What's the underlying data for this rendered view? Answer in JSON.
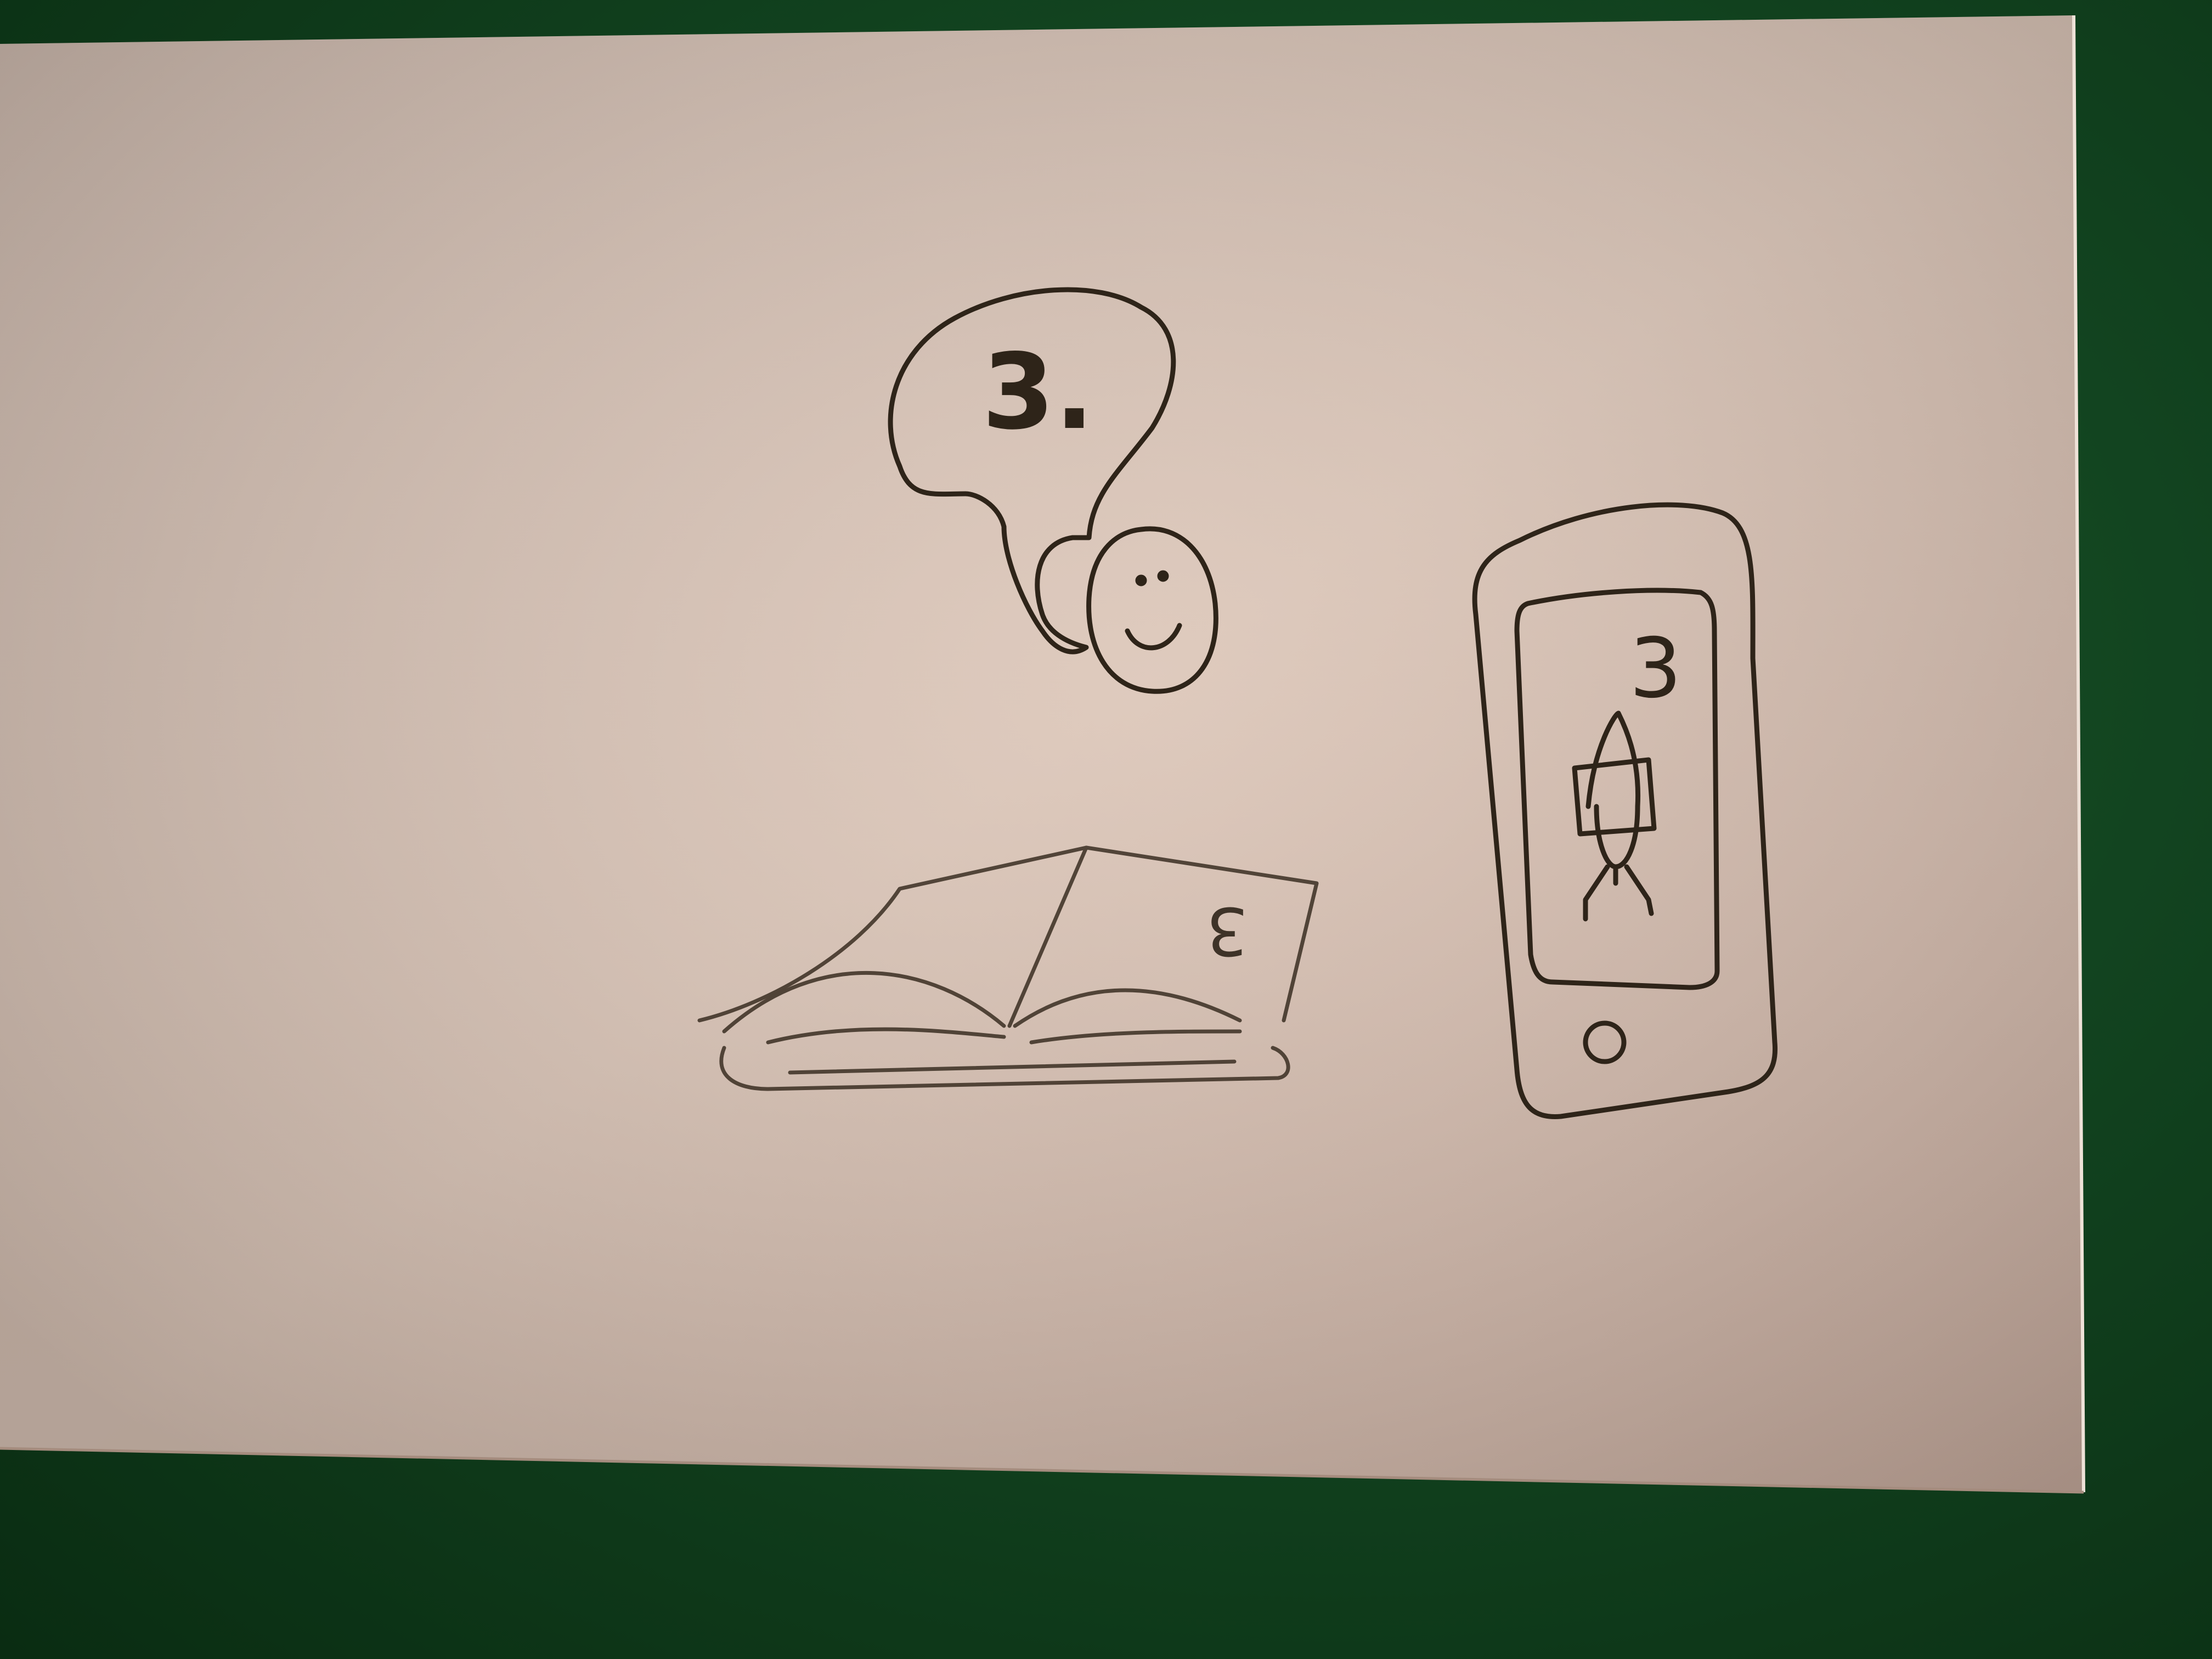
{
  "scene": {
    "description_kind": "photo of hand sketch on index card",
    "colors": {
      "background": "#124420",
      "card": "#d9c3b4",
      "card_shadow": "#b89c8c",
      "ink": "#2e2419"
    }
  },
  "thought_bubble": {
    "text": "3."
  },
  "book": {
    "text": "3"
  },
  "phone": {
    "screen_text": "3"
  }
}
